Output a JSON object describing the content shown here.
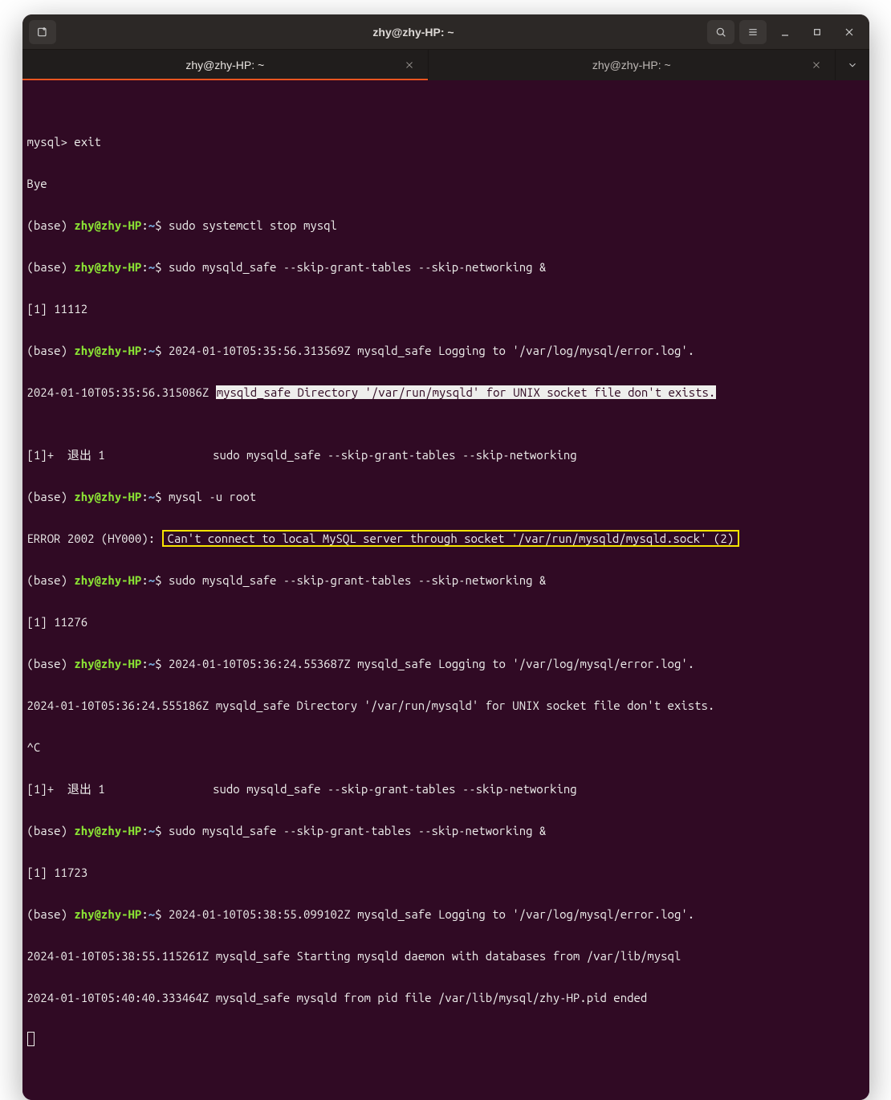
{
  "window": {
    "title": "zhy@zhy-HP: ~"
  },
  "tabs": [
    {
      "label": "zhy@zhy-HP: ~",
      "active": true
    },
    {
      "label": "zhy@zhy-HP: ~",
      "active": false
    }
  ],
  "prompt": {
    "base": "(base) ",
    "userhost": "zhy@zhy-HP",
    "colon": ":",
    "path": "~",
    "dollar": "$ "
  },
  "term": {
    "l1": "",
    "l2": "mysql> exit",
    "l3": "Bye",
    "c1": "sudo systemctl stop mysql",
    "c2": "sudo mysqld_safe --skip-grant-tables --skip-networking &",
    "l6": "[1] 11112",
    "c3": "2024-01-10T05:35:56.313569Z mysqld_safe Logging to '/var/log/mysql/error.log'.",
    "l8a": "2024-01-10T05:35:56.315086Z ",
    "l8b": "mysqld_safe Directory '/var/run/mysqld' for UNIX socket file don't exists.",
    "l9": "",
    "l10": "[1]+  退出 1                sudo mysqld_safe --skip-grant-tables --skip-networking",
    "c4": "mysql -u root",
    "l12a": "ERROR 2002 (HY000): ",
    "l12b": "Can't connect to local MySQL server through socket '/var/run/mysqld/mysqld.sock' (2)",
    "c5": "sudo mysqld_safe --skip-grant-tables --skip-networking &",
    "l14": "[1] 11276",
    "c6": "2024-01-10T05:36:24.553687Z mysqld_safe Logging to '/var/log/mysql/error.log'.",
    "l16": "2024-01-10T05:36:24.555186Z mysqld_safe Directory '/var/run/mysqld' for UNIX socket file don't exists.",
    "l17": "^C",
    "l18": "[1]+  退出 1                sudo mysqld_safe --skip-grant-tables --skip-networking",
    "c7": "sudo mysqld_safe --skip-grant-tables --skip-networking &",
    "l20": "[1] 11723",
    "c8": "2024-01-10T05:38:55.099102Z mysqld_safe Logging to '/var/log/mysql/error.log'.",
    "l22": "2024-01-10T05:38:55.115261Z mysqld_safe Starting mysqld daemon with databases from /var/lib/mysql",
    "l23": "2024-01-10T05:40:40.333464Z mysqld_safe mysqld from pid file /var/lib/mysql/zhy-HP.pid ended"
  }
}
